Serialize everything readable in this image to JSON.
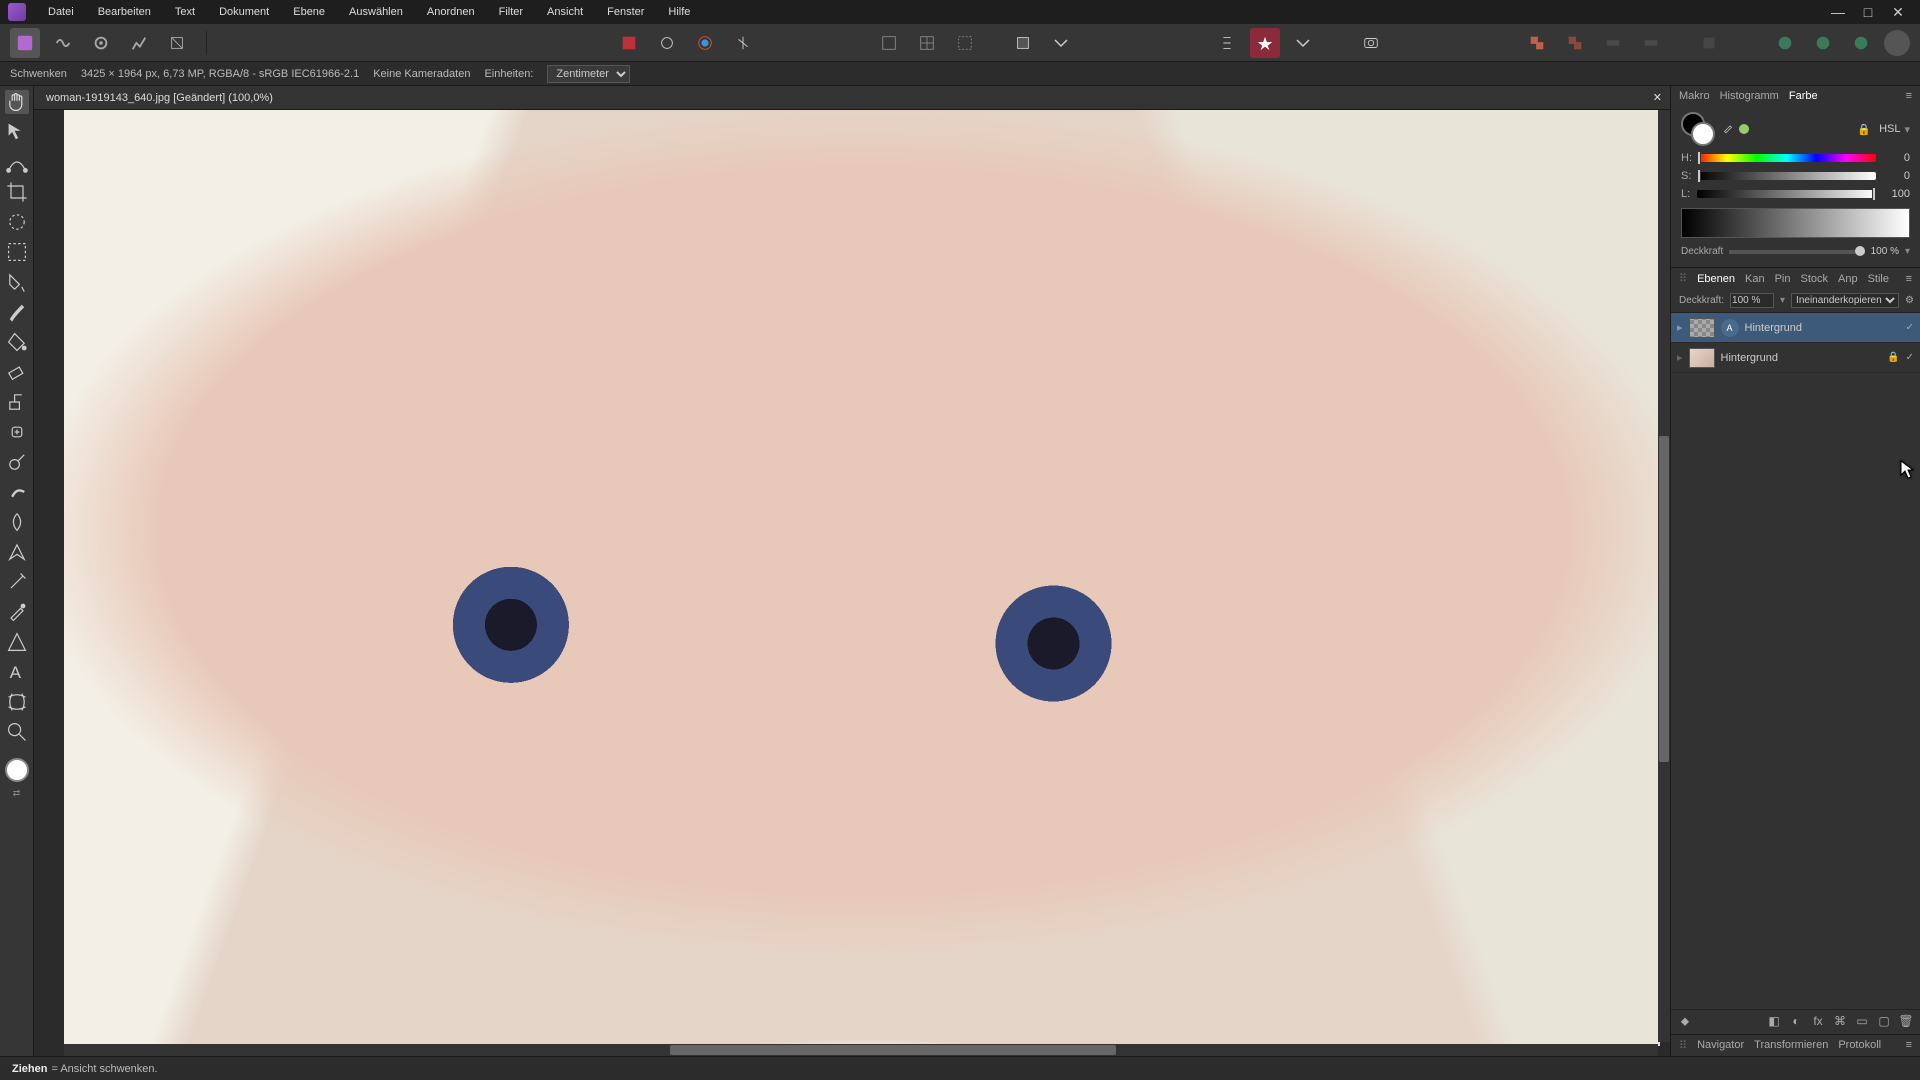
{
  "menu": [
    "Datei",
    "Bearbeiten",
    "Text",
    "Dokument",
    "Ebene",
    "Auswählen",
    "Anordnen",
    "Filter",
    "Ansicht",
    "Fenster",
    "Hilfe"
  ],
  "context": {
    "tool_label": "Schwenken",
    "dims": "3425 × 1964 px, 6,73 MP, RGBA/8 - sRGB IEC61966-2.1",
    "camera": "Keine Kameradaten",
    "units_label": "Einheiten:",
    "units_value": "Zentimeter"
  },
  "doc_tab": {
    "title": "woman-1919143_640.jpg [Geändert] (100,0%)"
  },
  "studio_tabs_top": {
    "items": [
      "Makro",
      "Histogramm",
      "Farbe"
    ],
    "active": "Farbe"
  },
  "color_panel": {
    "mode": "HSL",
    "h": 0,
    "s": 0,
    "l": 100,
    "opacity_label": "Deckkraft",
    "opacity_value": "100 %"
  },
  "studio_tabs_mid": {
    "items": [
      "Ebenen",
      "Kan",
      "Pin",
      "Stock",
      "Anp",
      "Stile"
    ],
    "active": "Ebenen"
  },
  "layers_panel": {
    "opacity_label": "Deckkraft:",
    "opacity_value": "100 %",
    "blend_mode": "Ineinanderkopieren",
    "layers": [
      {
        "name": "Hintergrund",
        "type": "adjustment",
        "selected": true,
        "locked": false,
        "visible": true
      },
      {
        "name": "Hintergrund",
        "type": "pixel",
        "selected": false,
        "locked": true,
        "visible": true
      }
    ]
  },
  "studio_tabs_bottom": [
    "Navigator",
    "Transformieren",
    "Protokoll"
  ],
  "status": {
    "verb": "Ziehen",
    "hint": "= Ansicht schwenken."
  },
  "tools": [
    "hand",
    "move",
    "crop",
    "select-rect",
    "lasso",
    "flood-select",
    "brush",
    "erase",
    "fill",
    "gradient",
    "dodge",
    "clone",
    "heal",
    "smudge",
    "blur",
    "pen",
    "text",
    "shape",
    "zoom",
    "color-picker"
  ]
}
